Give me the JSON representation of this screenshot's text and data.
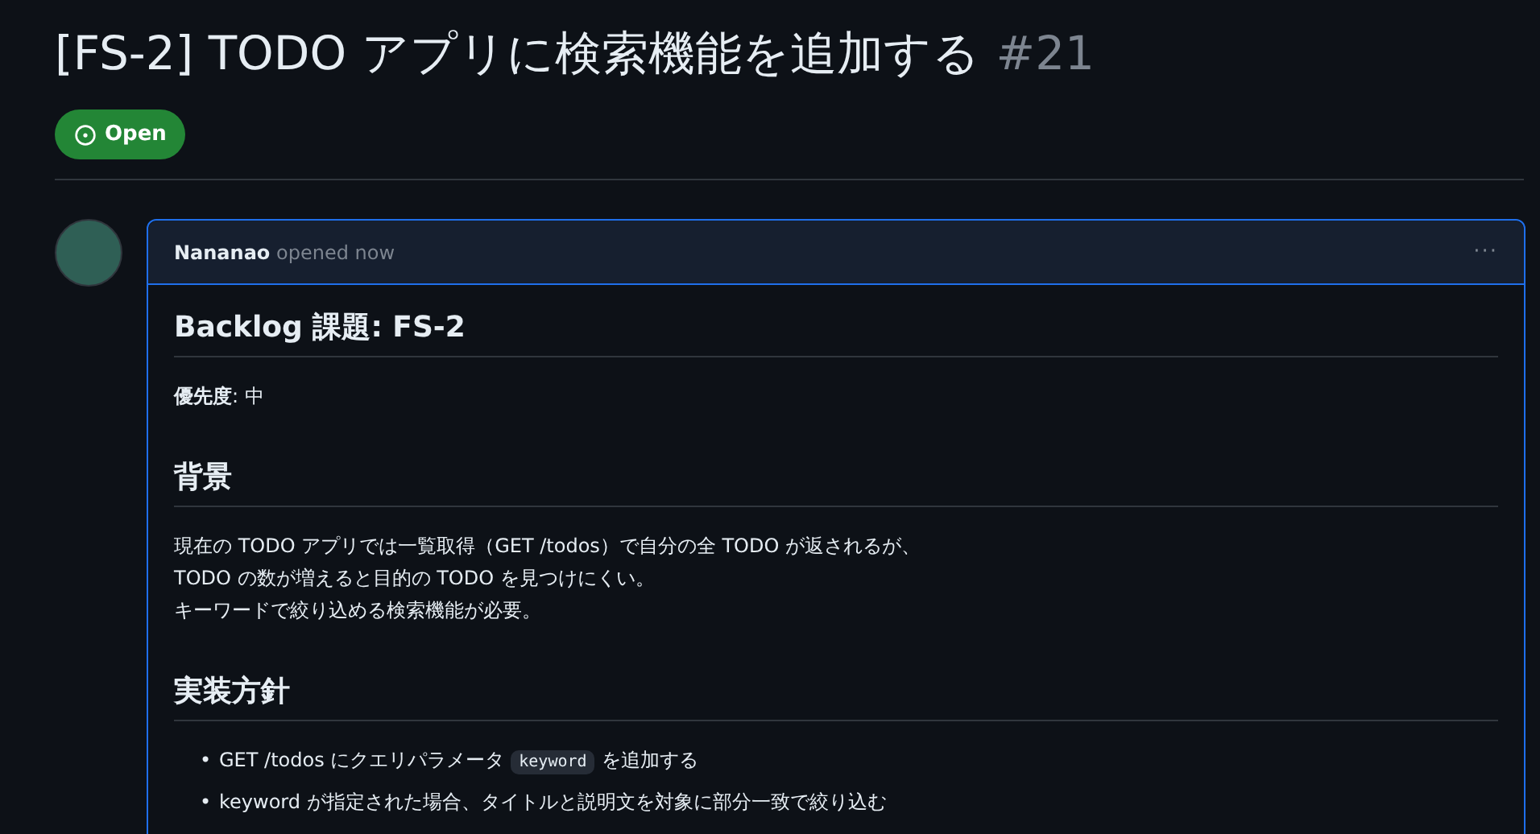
{
  "issue": {
    "title": "[FS-2] TODO アプリに検索機能を追加する",
    "number": "#21",
    "state": "Open"
  },
  "comment": {
    "author": "Nananao",
    "action": "opened now",
    "menu": "···",
    "body": [
      {
        "kind": "h2",
        "text": "Backlog 課題: FS-2"
      },
      {
        "kind": "p",
        "lines": [
          "**優先度**: 中"
        ]
      },
      {
        "kind": "h2",
        "text": "背景"
      },
      {
        "kind": "p",
        "lines": [
          "現在の TODO アプリでは一覧取得（GET /todos）で自分の全 TODO が返されるが、",
          "TODO の数が増えると目的の TODO を見つけにくい。",
          "キーワードで絞り込める検索機能が必要。"
        ]
      },
      {
        "kind": "h2",
        "text": "実装方針"
      },
      {
        "kind": "ul",
        "items": [
          {
            "marker": "•",
            "parts": [
              {
                "kind": "text",
                "text": "GET /todos にクエリパラメータ"
              },
              {
                "kind": "code",
                "text": "keyword"
              },
              {
                "kind": "text",
                "text": "を追加する"
              }
            ]
          },
          {
            "marker": "•",
            "parts": [
              {
                "kind": "text",
                "text": "keyword が指定された場合、タイトルと説明文を対象に部分一致で絞り込む"
              }
            ]
          }
        ]
      }
    ]
  }
}
